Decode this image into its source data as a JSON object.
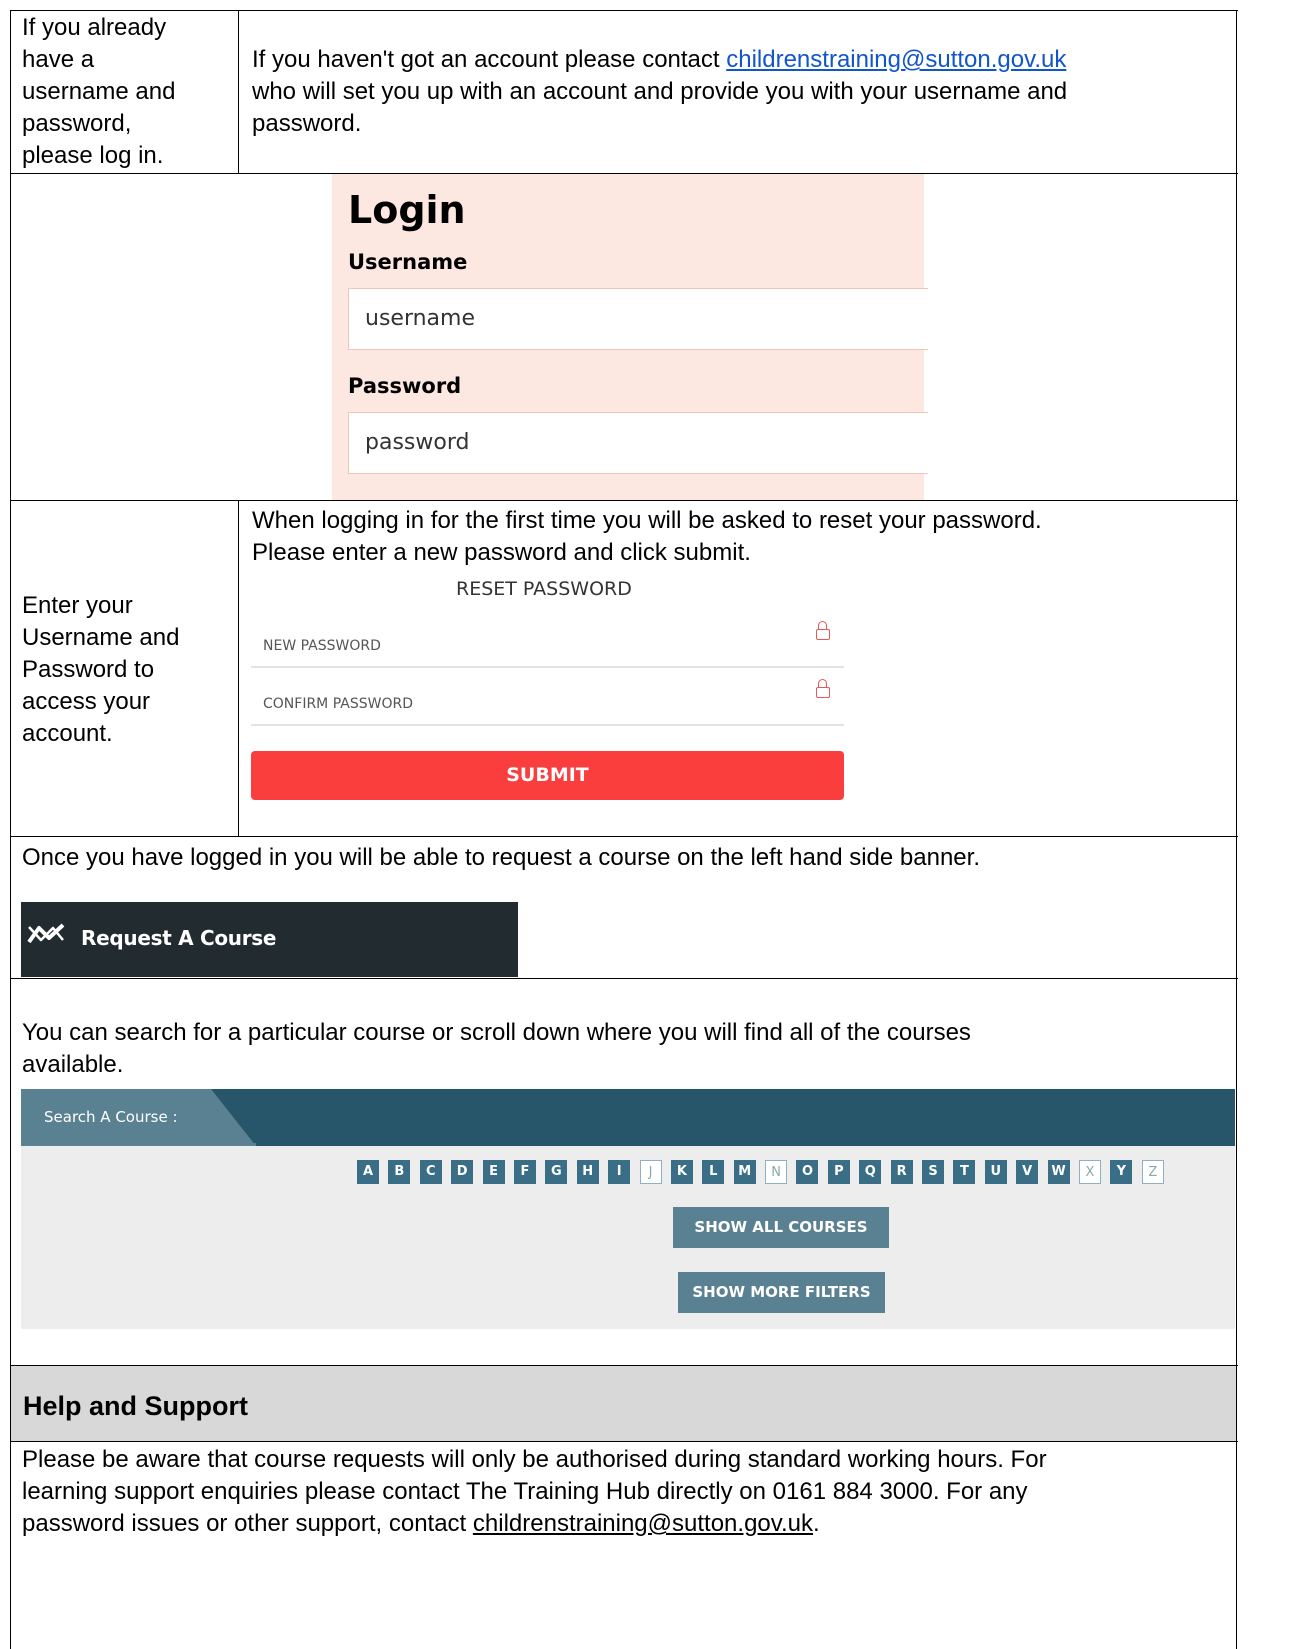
{
  "row1": {
    "left_text": [
      "If you already",
      "have a",
      "username and",
      "password,",
      "please log in."
    ],
    "right_prefix": "If you haven't got an account please contact ",
    "right_email": "childrenstraining@sutton.gov.uk",
    "right_line2": "who will set you up with an account and provide you with your username and",
    "right_line3": "password."
  },
  "login": {
    "title": "Login",
    "username_label": "Username",
    "username_value": "username",
    "password_label": "Password",
    "password_value": "password"
  },
  "row3": {
    "left_text": [
      "Enter your",
      "Username and",
      "Password to",
      "access your",
      "account."
    ],
    "intro_line1": "When logging in for the first time you will be asked to reset your password.",
    "intro_line2": "Please enter a new password and click submit.",
    "reset_title": "RESET PASSWORD",
    "new_password": "NEW PASSWORD",
    "confirm_password": "CONFIRM PASSWORD",
    "submit": "SUBMIT"
  },
  "row4": {
    "text": "Once you have logged in you will be able to request a course on the left hand side banner.",
    "banner_label": "Request A Course",
    "banner_icon": "request-course-icon"
  },
  "row5": {
    "line1": "You can search for a particular course or scroll down where you will find all of the courses",
    "line2": "available.",
    "search_tab": "Search A Course :",
    "letters": [
      "A",
      "B",
      "C",
      "D",
      "E",
      "F",
      "G",
      "H",
      "I",
      "J",
      "K",
      "L",
      "M",
      "N",
      "O",
      "P",
      "Q",
      "R",
      "S",
      "T",
      "U",
      "V",
      "W",
      "X",
      "Y",
      "Z"
    ],
    "disabled_letters": [
      "J",
      "N",
      "X",
      "Z"
    ],
    "show_all": "SHOW ALL COURSES",
    "show_more": "SHOW MORE FILTERS"
  },
  "help": {
    "heading": "Help and Support",
    "line1": "Please be aware that course requests will only be authorised during standard working hours. For",
    "line2": "learning support enquiries please contact The Training Hub directly on 0161 884 3000. For any",
    "line3_prefix": "password issues or other support, contact ",
    "email": "childrenstraining@sutton.gov.uk",
    "line3_suffix": "."
  },
  "colors": {
    "link": "#1155cc",
    "submit_bg": "#fa3e3e",
    "login_bg": "#fde7e1",
    "search_bar": "#275569",
    "letter_bg": "#3a6e86",
    "banner_bg": "#222b30"
  }
}
